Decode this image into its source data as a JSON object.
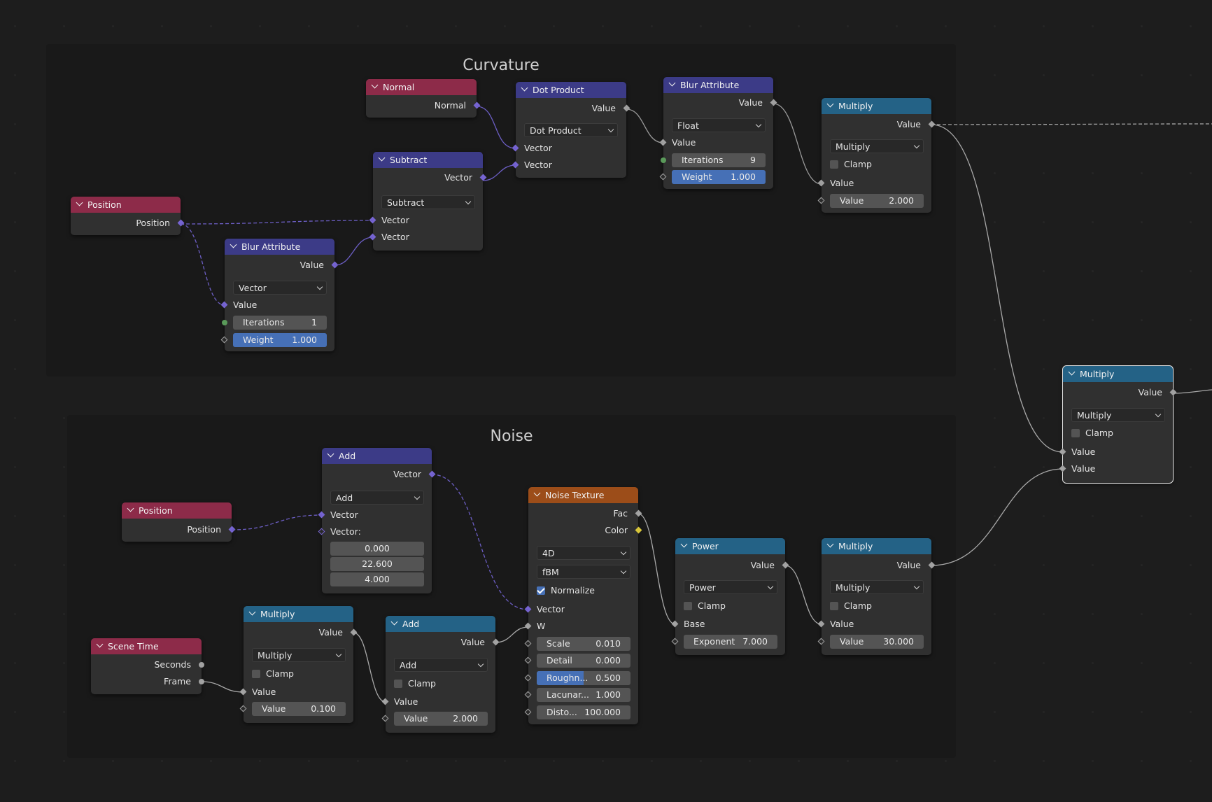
{
  "frames": {
    "curvature": {
      "title": "Curvature"
    },
    "noise": {
      "title": "Noise"
    }
  },
  "colors": {
    "geometry": "#8d2b49",
    "vector_math": "#3c3b87",
    "math": "#246286",
    "texture": "#9c4d19",
    "vector_socket": "#7664d2",
    "float_socket": "#a1a1a1",
    "color_socket": "#d7c53a",
    "field_highlight": "#4670b6"
  },
  "nodes": {
    "normal": {
      "title": "Normal",
      "output": "Normal"
    },
    "position_a": {
      "title": "Position",
      "output": "Position"
    },
    "dot_product": {
      "title": "Dot Product",
      "output": "Value",
      "operation": "Dot Product",
      "input1": "Vector",
      "input2": "Vector"
    },
    "subtract": {
      "title": "Subtract",
      "output": "Vector",
      "operation": "Subtract",
      "input1": "Vector",
      "input2": "Vector"
    },
    "blur_a": {
      "title": "Blur Attribute",
      "output": "Value",
      "data_type": "Vector",
      "input": "Value",
      "iterations_label": "Iterations",
      "iterations": "1",
      "weight_label": "Weight",
      "weight": "1.000"
    },
    "blur_b": {
      "title": "Blur Attribute",
      "output": "Value",
      "data_type": "Float",
      "input": "Value",
      "iterations_label": "Iterations",
      "iterations": "9",
      "weight_label": "Weight",
      "weight": "1.000"
    },
    "multiply_a": {
      "title": "Multiply",
      "output": "Value",
      "operation": "Multiply",
      "clamp": "Clamp",
      "input1": "Value",
      "value_label": "Value",
      "value": "2.000"
    },
    "multiply_final": {
      "title": "Multiply",
      "output": "Value",
      "operation": "Multiply",
      "clamp": "Clamp",
      "input1": "Value",
      "input2": "Value"
    },
    "add_vec": {
      "title": "Add",
      "output": "Vector",
      "operation": "Add",
      "input1": "Vector",
      "input2": "Vector:",
      "x": "0.000",
      "y": "22.600",
      "z": "4.000"
    },
    "position_b": {
      "title": "Position",
      "output": "Position"
    },
    "scene_time": {
      "title": "Scene Time",
      "seconds": "Seconds",
      "frame": "Frame"
    },
    "multiply_b": {
      "title": "Multiply",
      "output": "Value",
      "operation": "Multiply",
      "clamp": "Clamp",
      "input1": "Value",
      "value_label": "Value",
      "value": "0.100"
    },
    "add_math": {
      "title": "Add",
      "output": "Value",
      "operation": "Add",
      "clamp": "Clamp",
      "input1": "Value",
      "value_label": "Value",
      "value": "2.000"
    },
    "noise": {
      "title": "Noise Texture",
      "fac": "Fac",
      "color": "Color",
      "dimensions": "4D",
      "type": "fBM",
      "normalize": "Normalize",
      "vector": "Vector",
      "w": "W",
      "scale_label": "Scale",
      "scale": "0.010",
      "detail_label": "Detail",
      "detail": "0.000",
      "roughness_label": "Roughn...",
      "roughness": "0.500",
      "roughness_fraction": 0.5,
      "lacunarity_label": "Lacunar...",
      "lacunarity": "1.000",
      "distortion_label": "Disto...",
      "distortion": "100.000"
    },
    "power": {
      "title": "Power",
      "output": "Value",
      "operation": "Power",
      "clamp": "Clamp",
      "base": "Base",
      "exponent_label": "Exponent",
      "exponent": "7.000"
    },
    "multiply_c": {
      "title": "Multiply",
      "output": "Value",
      "operation": "Multiply",
      "clamp": "Clamp",
      "input1": "Value",
      "value_label": "Value",
      "value": "30.000"
    }
  }
}
